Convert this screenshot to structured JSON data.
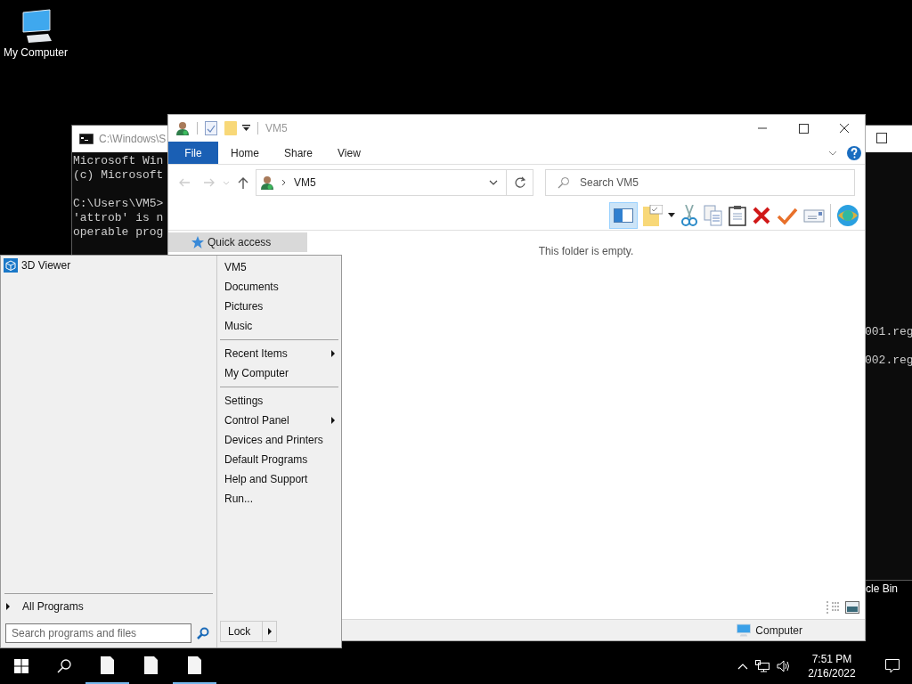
{
  "desktop_icons": [
    {
      "kind": "computer",
      "label": "My Computer"
    },
    {
      "kind": "bin",
      "label": "cle Bin"
    }
  ],
  "console": {
    "title": "C:\\Windows\\S",
    "blocks": [
      [
        "Microsoft Win",
        "(c) Microsoft"
      ],
      [
        "C:\\Users\\VM5>",
        "'attrob' is n",
        "operable prog"
      ]
    ],
    "right_lines": [
      "001.reg",
      "002.reg"
    ]
  },
  "explorer": {
    "title": "VM5",
    "ribbon_tabs": [
      {
        "label": "File",
        "kind": "file"
      },
      {
        "label": "Home",
        "kind": "tab"
      },
      {
        "label": "Share",
        "kind": "tab"
      },
      {
        "label": "View",
        "kind": "tab"
      }
    ],
    "address": "VM5",
    "search_placeholder": "Search VM5",
    "nav_items": [
      {
        "label": "Quick access",
        "selected": true
      }
    ],
    "empty_message": "This folder is empty.",
    "status_location": "Computer"
  },
  "start_menu": {
    "programs": [
      {
        "label": "3D Viewer"
      }
    ],
    "all_programs": "All Programs",
    "search_placeholder": "Search programs and files",
    "groups": [
      [
        {
          "label": "VM5",
          "submenu": false
        },
        {
          "label": "Documents",
          "submenu": false
        },
        {
          "label": "Pictures",
          "submenu": false
        },
        {
          "label": "Music",
          "submenu": false
        }
      ],
      [
        {
          "label": "Recent Items",
          "submenu": true
        },
        {
          "label": "My Computer",
          "submenu": false
        }
      ],
      [
        {
          "label": "Settings",
          "submenu": false
        },
        {
          "label": "Control Panel",
          "submenu": true
        },
        {
          "label": "Devices and Printers",
          "submenu": false
        },
        {
          "label": "Default Programs",
          "submenu": false
        },
        {
          "label": "Help and Support",
          "submenu": false
        },
        {
          "label": "Run...",
          "submenu": false
        }
      ]
    ],
    "lock": "Lock"
  },
  "taskbar": {
    "apps": [
      {
        "running": true
      },
      {
        "running": false
      },
      {
        "running": true
      }
    ],
    "time": "7:51 PM",
    "date": "2/16/2022"
  }
}
